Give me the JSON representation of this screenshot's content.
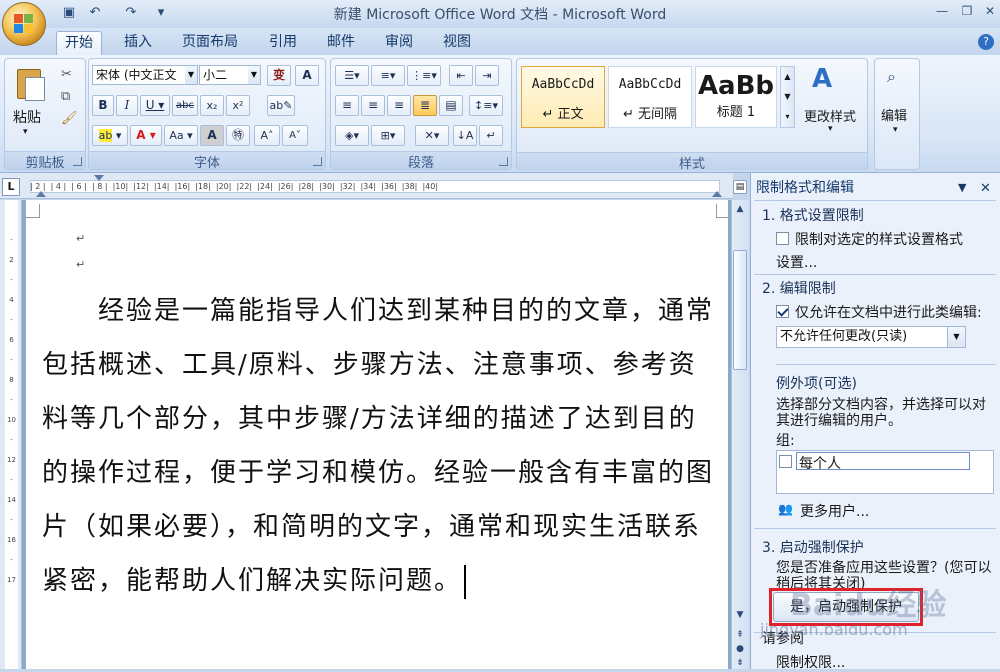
{
  "window": {
    "title": "新建 Microsoft Office Word 文档 - Microsoft Word"
  },
  "quick_access": [
    "save-icon",
    "undo-icon",
    "redo-icon",
    "customize-icon"
  ],
  "tabs": [
    "开始",
    "插入",
    "页面布局",
    "引用",
    "邮件",
    "审阅",
    "视图"
  ],
  "active_tab": "开始",
  "ribbon": {
    "clipboard": {
      "paste_label": "粘贴",
      "group_label": "剪贴板"
    },
    "font": {
      "font_name": "宋体 (中文正文",
      "font_size": "小二",
      "group_label": "字体",
      "btn_wen": "变",
      "btn_a": "A"
    },
    "paragraph": {
      "group_label": "段落"
    },
    "styles": {
      "group_label": "样式",
      "items": [
        {
          "sample": "AaBbCcDd",
          "name": "↵ 正文"
        },
        {
          "sample": "AaBbCcDd",
          "name": "↵ 无间隔"
        },
        {
          "sample": "AaBb",
          "name": "标题 1"
        }
      ],
      "change_styles": "更改样式"
    },
    "editing": {
      "label": "编辑"
    }
  },
  "ruler": {
    "numbers": "| 2 |  | 4 |  | 6 |  | 8 |  |10|  |12|  |14|  |16|  |18|  |20|  |22|  |24|  |26|  |28|  |30|  |32|  |34|  |36|  |38|  |40|",
    "tab_selector": "L"
  },
  "document": {
    "paragraph": "经验是一篇能指导人们达到某种目的的文章，通常包括概述、工具/原料、步骤方法、注意事项、参考资料等几个部分，其中步骤/方法详细的描述了达到目的的操作过程，便于学习和模仿。经验一般含有丰富的图片（如果必要），和简明的文字，通常和现实生活联系紧密，能帮助人们解决实际问题。",
    "paragraph_mark": "↵"
  },
  "pane": {
    "title": "限制格式和编辑",
    "section1_title": "1. 格式设置限制",
    "section1_check_label": "限制对选定的样式设置格式",
    "section1_settings_link": "设置...",
    "section2_title": "2. 编辑限制",
    "section2_check_label": "仅允许在文档中进行此类编辑:",
    "section2_select_value": "不允许任何更改(只读)",
    "exceptions_title": "例外项(可选)",
    "exceptions_desc": "选择部分文档内容，并选择可以对其进行编辑的用户。",
    "group_label": "组:",
    "group_item": "每个人",
    "more_users": "更多用户...",
    "section3_title": "3. 启动强制保护",
    "section3_desc": "您是否准备应用这些设置？(您可以稍后将其关闭)",
    "protect_button": "是，启动强制保护",
    "see_also": "请参阅",
    "permission_link": "限制权限..."
  },
  "watermark": {
    "text": "Baidu经验",
    "url": "jingyan.baidu.com"
  },
  "highlight_color": "#e0232a"
}
